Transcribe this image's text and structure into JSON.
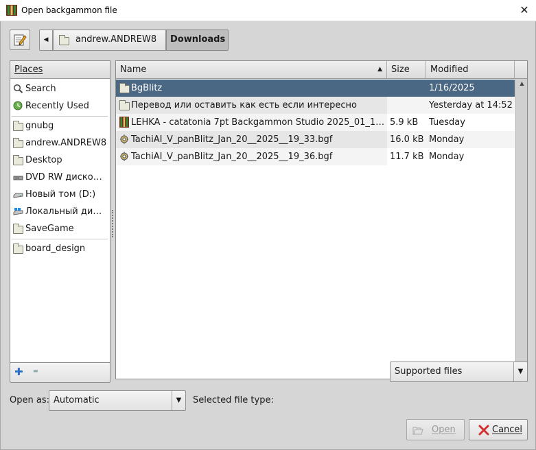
{
  "window": {
    "title": "Open backgammon file",
    "close_glyph": "✕"
  },
  "toolbar": {
    "back_glyph": "◀",
    "path": [
      "andrew.ANDREW8",
      "Downloads"
    ]
  },
  "places": {
    "header": "Places",
    "items": [
      {
        "label": "Search",
        "icon": "search-icon"
      },
      {
        "label": "Recently Used",
        "icon": "recent-icon"
      },
      {
        "label": "gnubg",
        "icon": "folder-icon"
      },
      {
        "label": "andrew.ANDREW8",
        "icon": "folder-icon"
      },
      {
        "label": "Desktop",
        "icon": "folder-icon"
      },
      {
        "label": "DVD RW диско…",
        "icon": "dvd-drive-icon"
      },
      {
        "label": "Новый том (D:)",
        "icon": "drive-icon"
      },
      {
        "label": "Локальный ди…",
        "icon": "system-drive-icon"
      },
      {
        "label": "SaveGame",
        "icon": "folder-icon"
      },
      {
        "label": "board_design",
        "icon": "folder-icon"
      }
    ],
    "add_glyph": "✚",
    "remove_glyph": "▬"
  },
  "files": {
    "columns": {
      "name": "Name",
      "size": "Size",
      "modified": "Modified",
      "sort_glyph": "▲"
    },
    "rows": [
      {
        "name": "BgBlitz",
        "size": "",
        "modified": "1/16/2025",
        "icon": "folder-icon",
        "selected": true
      },
      {
        "name": "Перевод или оставить как есть если интересно",
        "size": "",
        "modified": "Yesterday at 14:52",
        "icon": "folder-icon",
        "selected": false
      },
      {
        "name": "LEHKA - catatonia 7pt Backgammon Studio 2025_01_1…",
        "size": "5.9 kB",
        "modified": "Tuesday",
        "icon": "backgammon-file-icon",
        "selected": false
      },
      {
        "name": "TachiAI_V_panBlitz_Jan_20__2025__19_33.bgf",
        "size": "16.0 kB",
        "modified": "Monday",
        "icon": "bgf-file-icon",
        "selected": false
      },
      {
        "name": "TachiAI_V_panBlitz_Jan_20__2025__19_36.bgf",
        "size": "11.7 kB",
        "modified": "Monday",
        "icon": "bgf-file-icon",
        "selected": false
      }
    ]
  },
  "filter": {
    "value": "Supported files",
    "arrow_glyph": "▼"
  },
  "open_as": {
    "label": "Open as:",
    "value": "Automatic",
    "arrow_glyph": "▼"
  },
  "selected_file_type": {
    "label": "Selected file type:"
  },
  "buttons": {
    "open": "Open",
    "cancel": "Cancel"
  },
  "colors": {
    "selection": "#4a6784",
    "dialog_bg": "#d6d6d6",
    "accent_blue": "#2b6cc4"
  }
}
